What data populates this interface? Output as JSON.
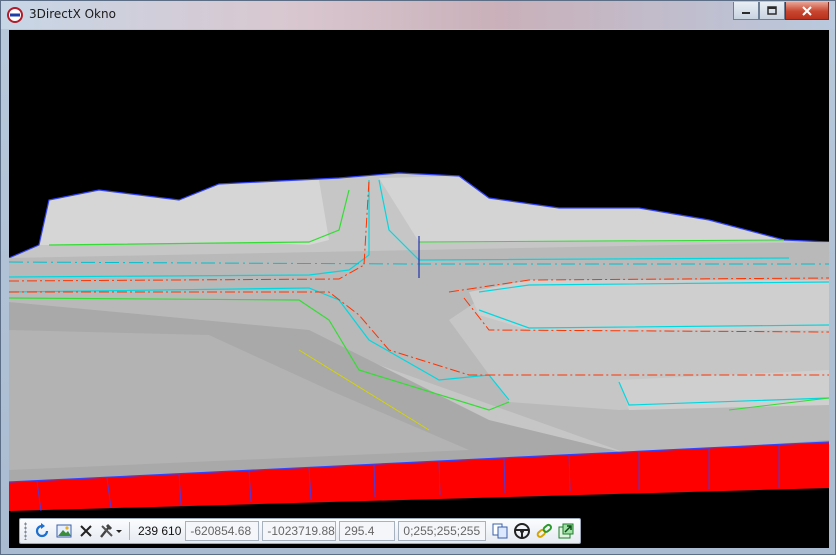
{
  "window": {
    "title": "3DirectX Okno"
  },
  "toolbar": {
    "count": "239 610",
    "coord_x": "-620854.68",
    "coord_y": "-1023719.88",
    "coord_z": "295.4",
    "color": "0;255;255;255",
    "icons": [
      "refresh-icon",
      "image-icon",
      "close-icon",
      "tools-icon",
      "copy-icon",
      "steering-wheel-icon",
      "link-icon",
      "export-icon"
    ]
  },
  "colors": {
    "terrain": "#c8c8c8",
    "road_edge": "#00e0e0",
    "road_center": "#ff3300",
    "verge": "#33dd33",
    "skirt": "#ff0000",
    "horizon_line": "#3344ff"
  }
}
